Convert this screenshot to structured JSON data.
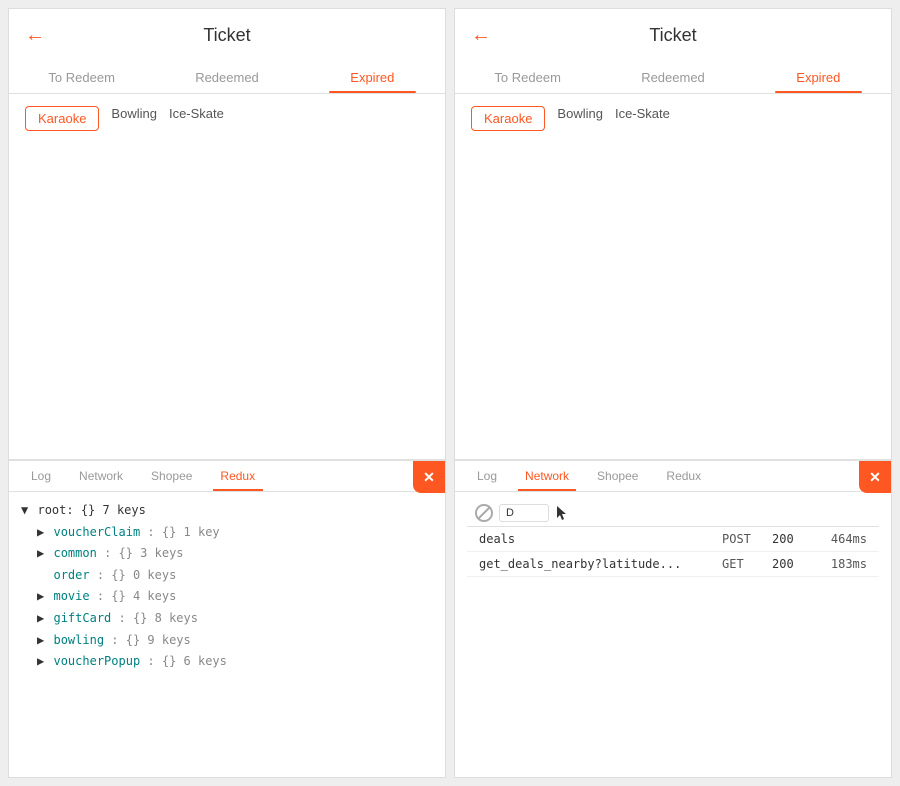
{
  "panels": [
    {
      "id": "left",
      "ticket": {
        "back_label": "←",
        "title": "Ticket",
        "tabs": [
          {
            "id": "to-redeem",
            "label": "To Redeem",
            "active": false
          },
          {
            "id": "redeemed",
            "label": "Redeemed",
            "active": false
          },
          {
            "id": "expired",
            "label": "Expired",
            "active": true
          }
        ],
        "categories": [
          {
            "id": "karaoke",
            "label": "Karaoke",
            "selected": true
          },
          {
            "id": "bowling",
            "label": "Bowling",
            "selected": false
          },
          {
            "id": "ice-skate",
            "label": "Ice-Skate",
            "selected": false
          }
        ]
      },
      "dev": {
        "active_tab": "Redux",
        "tabs": [
          "Log",
          "Network",
          "Shopee",
          "Redux"
        ],
        "content_type": "redux",
        "tree": {
          "root_label": "root: {} 7 keys",
          "children": [
            {
              "key": "voucherClaim",
              "value": "{} 1 key",
              "expandable": true
            },
            {
              "key": "common",
              "value": "{} 3 keys",
              "expandable": true
            },
            {
              "key": "order",
              "value": "{} 0 keys",
              "expandable": false
            },
            {
              "key": "movie",
              "value": "{} 4 keys",
              "expandable": true
            },
            {
              "key": "giftCard",
              "value": "{} 8 keys",
              "expandable": true
            },
            {
              "key": "bowling",
              "value": "{} 9 keys",
              "expandable": true
            },
            {
              "key": "voucherPopup",
              "value": "{} 6 keys",
              "expandable": true
            }
          ]
        }
      }
    },
    {
      "id": "right",
      "ticket": {
        "back_label": "←",
        "title": "Ticket",
        "tabs": [
          {
            "id": "to-redeem",
            "label": "To Redeem",
            "active": false
          },
          {
            "id": "redeemed",
            "label": "Redeemed",
            "active": false
          },
          {
            "id": "expired",
            "label": "Expired",
            "active": true
          }
        ],
        "categories": [
          {
            "id": "karaoke",
            "label": "Karaoke",
            "selected": true
          },
          {
            "id": "bowling",
            "label": "Bowling",
            "selected": false
          },
          {
            "id": "ice-skate",
            "label": "Ice-Skate",
            "selected": false
          }
        ]
      },
      "dev": {
        "active_tab": "Network",
        "tabs": [
          "Log",
          "Network",
          "Shopee",
          "Redux"
        ],
        "content_type": "network",
        "filter_placeholder": "D",
        "network_rows": [
          {
            "name": "deals",
            "method": "POST",
            "status": "200",
            "time": "464ms"
          },
          {
            "name": "get_deals_nearby?latitude...",
            "method": "GET",
            "status": "200",
            "time": "183ms"
          }
        ]
      }
    }
  ],
  "colors": {
    "accent": "#ff5722",
    "text_primary": "#333",
    "text_secondary": "#999",
    "tree_key": "#008080",
    "border": "#e0e0e0"
  }
}
